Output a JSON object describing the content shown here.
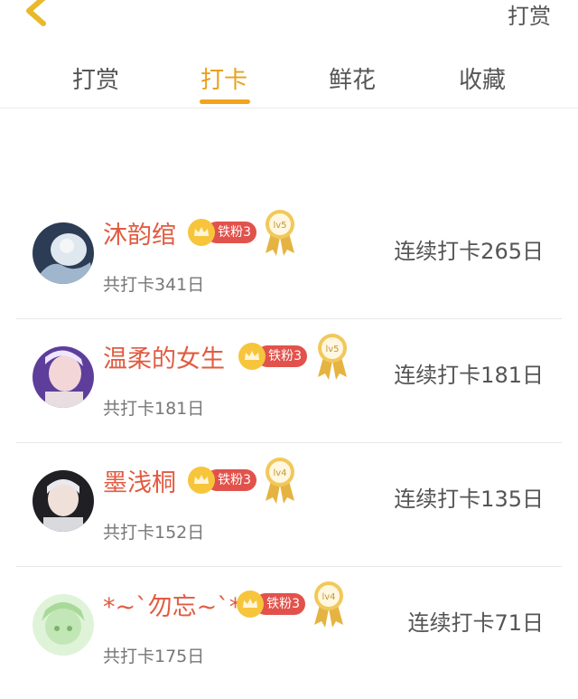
{
  "header": {
    "right_label": "打赏"
  },
  "tabs": [
    {
      "label": "打赏",
      "active": false
    },
    {
      "label": "打卡",
      "active": true
    },
    {
      "label": "鲜花",
      "active": false
    },
    {
      "label": "收藏",
      "active": false
    }
  ],
  "colors": {
    "accent": "#f2a51a",
    "name": "#e15b41",
    "badge": "#e2524c"
  },
  "rows": [
    {
      "name": "沐韵绾",
      "fan_badge": "铁粉3",
      "level": "lv5",
      "total": "共打卡341日",
      "streak": "连续打卡265日",
      "avatar_icon": "avatar-silver-figure"
    },
    {
      "name": "温柔的女生",
      "fan_badge": "铁粉3",
      "level": "lv5",
      "total": "共打卡181日",
      "streak": "连续打卡181日",
      "avatar_icon": "avatar-purple-portrait"
    },
    {
      "name": "墨浅桐",
      "fan_badge": "铁粉3",
      "level": "lv4",
      "total": "共打卡152日",
      "streak": "连续打卡135日",
      "avatar_icon": "avatar-dark-portrait"
    },
    {
      "name": "*~`勿忘~`*",
      "fan_badge": "铁粉3",
      "level": "lv4",
      "total": "共打卡175日",
      "streak": "连续打卡71日",
      "avatar_icon": "avatar-green-anime"
    }
  ]
}
